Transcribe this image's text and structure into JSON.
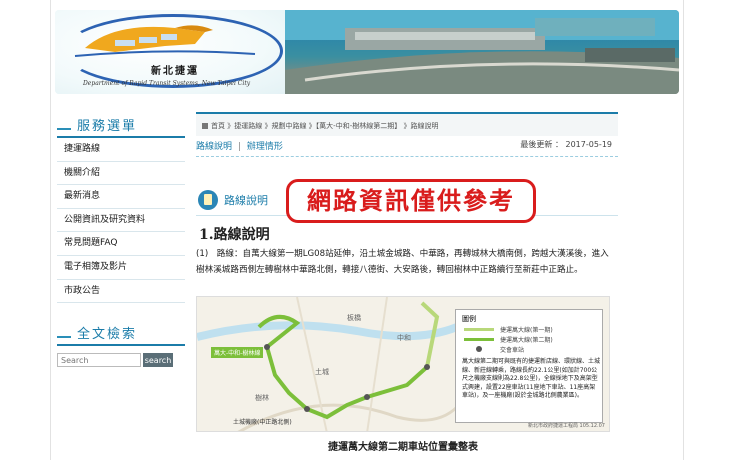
{
  "header": {
    "logo_title": "新北捷運",
    "logo_subtitle": "Department of Rapid Transit Systems, New Taipei City"
  },
  "sidebar": {
    "title": "服務選單",
    "items": [
      {
        "label": "捷運路線"
      },
      {
        "label": "機關介紹"
      },
      {
        "label": "最新消息"
      },
      {
        "label": "公開資訊及研究資料"
      },
      {
        "label": "常見問題FAQ"
      },
      {
        "label": "電子相簿及影片"
      },
      {
        "label": "市政公告"
      }
    ]
  },
  "search": {
    "title": "全文檢索",
    "placeholder": "Search",
    "button_label": "search"
  },
  "breadcrumb": "首頁 》捷運路線 》規劃中路線 》【萬大-中和-樹林線第二期】 》路線說明",
  "tabs": {
    "route_label": "路線說明",
    "progress_label": "辦理情形",
    "separator": "|"
  },
  "updated": "最後更新 ： 2017-05-19",
  "section": {
    "title": "路線說明",
    "heading": "1.路線說明",
    "paragraph": "(1)　路線：自萬大線第一期LG08站延伸，沿土城金城路、中華路，再轉城林大橋南側，跨越大漢溪後，進入樹林溪城路西側左轉樹林中華路北側，轉接八德街、大安路後，轉回樹林中正路續行至新莊中正路止。"
  },
  "watermark": "網路資訊僅供參考",
  "map": {
    "legend_title": "圖例",
    "legend_items": [
      {
        "label": "捷運萬大線(第一期)",
        "color": "#b8d87a"
      },
      {
        "label": "捷運萬大線(第二期)",
        "color": "#7cbf3a"
      },
      {
        "label": "交會車站",
        "color": "#555555"
      }
    ],
    "legend_note": "萬大線第二期可與既有的捷運新店線、環狀線、土城線、新莊線轉乘，路線長約22.1公里(如加計700公尺之機廠支線則為22.8公里)，全線採地下及高架型式興建，設置22座車站(11座地下車站、11座高架車站)，及一座機廠(設於金城路北側農業區)。",
    "source": "新北市政府捷運工程局 105.12.07",
    "labels": [
      "萬大-中和-樹林線",
      "中和",
      "土城",
      "樹林",
      "板橋",
      "土城機廠(中正路北側)"
    ]
  },
  "caption": "捷運萬大線第二期車站位置彙整表",
  "colors": {
    "accent": "#1b7ca9",
    "watermark": "#d91c1c",
    "route": "#7cbf3a"
  }
}
